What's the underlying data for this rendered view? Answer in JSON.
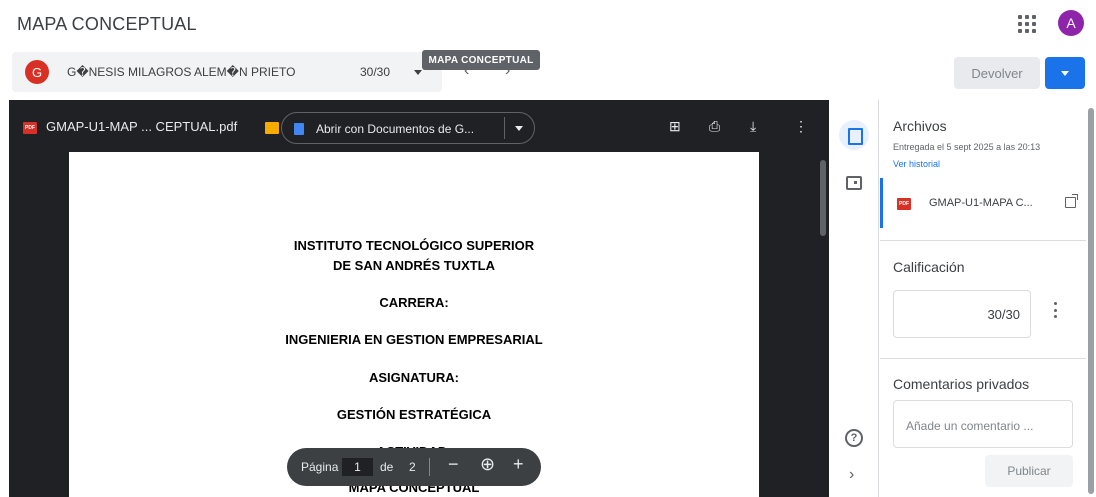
{
  "app": {
    "title": "MAPA CONCEPTUAL",
    "avatar_letter": "A"
  },
  "student": {
    "avatar_letter": "G",
    "name": "G�NESIS MILAGROS ALEM�N PRIETO",
    "grade": "30/30"
  },
  "tooltip": "MAPA CONCEPTUAL",
  "actions": {
    "return_label": "Devolver"
  },
  "viewer": {
    "file_icon": "PDF",
    "file_title": "GMAP-U1-MAP ... CEPTUAL.pdf",
    "open_with_label": "Abrir con Documentos de G...",
    "document_lines": [
      "INSTITUTO TECNOLÓGICO SUPERIOR",
      "DE SAN ANDRÉS TUXTLA",
      "CARRERA:",
      "INGENIERIA EN GESTION EMPRESARIAL",
      "ASIGNATURA:",
      "GESTIÓN ESTRATÉGICA",
      "ACTIVIDAD:",
      "MAPA CONCEPTUAL"
    ],
    "pager": {
      "page_label": "Página",
      "current_page": "1",
      "of_label": "de",
      "total_pages": "2"
    }
  },
  "panel": {
    "files_title": "Archivos",
    "turned_in": "Entregada el 5 sept 2025 a las 20:13",
    "history_link": "Ver historial",
    "attachment": {
      "icon": "PDF",
      "name": "GMAP-U1-MAPA C..."
    },
    "grade_title": "Calificación",
    "grade_value": "30/30",
    "comments_title": "Comentarios privados",
    "comment_placeholder": "Añade un comentario ...",
    "publish_label": "Publicar"
  },
  "colors": {
    "accent": "#1a73e8",
    "viewer_bg": "#202124",
    "avatar_a": "#8e24aa",
    "avatar_g": "#d93025"
  }
}
